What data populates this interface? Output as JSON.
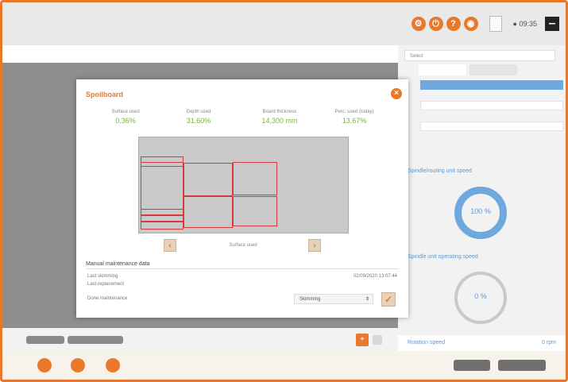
{
  "topbar": {
    "clock": "09:35"
  },
  "right_panel": {
    "field_top": "Select",
    "gauge1": {
      "title": "Spindle/routing unit speed",
      "value": "100 %"
    },
    "gauge2": {
      "title": "Spindle unit operating speed",
      "value": "0 %"
    },
    "footer_label": "Rotation speed",
    "footer_value": "0 rpm"
  },
  "dialog": {
    "title": "Spoilboard",
    "stats": [
      {
        "label": "Surface used",
        "value": "0.36%"
      },
      {
        "label": "Depth used",
        "value": "31.60%"
      },
      {
        "label": "Board thickness",
        "value": "14,300 mm"
      },
      {
        "label": "Perc. used (today)",
        "value": "13.67%"
      }
    ],
    "nav": {
      "label": "Surface used"
    },
    "maintenance": {
      "title": "Manual maintenance data",
      "last_skimming": "Last skimming",
      "last_replacement": "Last replacement",
      "last_value": "02/09/2020 13:07:44",
      "done_label": "Done maintenance",
      "select_value": "Skimming"
    }
  },
  "colors": {
    "accent": "#e9782a",
    "value_green": "#7ab53a",
    "area_red": "#d23b3b",
    "blue": "#5a9ad5"
  }
}
